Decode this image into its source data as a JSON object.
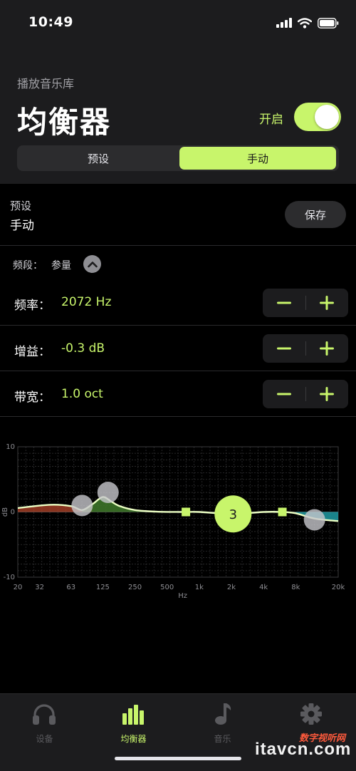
{
  "status_bar": {
    "time": "10:49"
  },
  "header": {
    "breadcrumb": "播放音乐库",
    "title": "均衡器",
    "toggle_label": "开启",
    "toggle_on": true
  },
  "segmented": {
    "preset": "预设",
    "manual": "手动",
    "selected": "手动"
  },
  "preset_row": {
    "caption": "预设",
    "value": "手动",
    "save_label": "保存"
  },
  "band": {
    "label": "频段：",
    "value": "参量"
  },
  "params": [
    {
      "label": "频率：",
      "value": "2072 Hz"
    },
    {
      "label": "增益：",
      "value": "-0.3 dB"
    },
    {
      "label": "带宽：",
      "value": "1.0 oct"
    }
  ],
  "chart": {
    "ylabel": "dB",
    "xlabel": "Hz",
    "y_ticks": [
      "10",
      "0",
      "-10"
    ],
    "x_ticks": [
      "20",
      "32",
      "63",
      "125",
      "250",
      "500",
      "1k",
      "2k",
      "4k",
      "8k",
      "20k"
    ],
    "selected_band_number": "3",
    "colors": {
      "accent": "#c8f56b",
      "handle_gray": "#c7c7cc",
      "low_fill": "#b5452a",
      "high_fill": "#1f9aa2"
    }
  },
  "chart_data": {
    "type": "line",
    "xlabel": "Hz",
    "ylabel": "dB",
    "ylim": [
      -10,
      10
    ],
    "xlim": [
      20,
      20000
    ],
    "x_scale": "log",
    "grid": true,
    "series": [
      {
        "x": [
          20,
          40,
          63,
          80,
          100,
          125,
          150,
          180,
          250,
          400,
          700,
          1000,
          2000,
          4000,
          6000,
          8000,
          12000,
          20000
        ],
        "y": [
          0.6,
          1.1,
          0.9,
          0.3,
          1.2,
          2.3,
          1.6,
          0.9,
          0.3,
          0.05,
          0.0,
          0.0,
          -0.3,
          0.0,
          0.0,
          -0.2,
          -1.0,
          -1.4
        ]
      }
    ],
    "handles": [
      {
        "label": "",
        "x": 80,
        "y": 1.0
      },
      {
        "label": "",
        "x": 140,
        "y": 3.0
      },
      {
        "label": "",
        "x": 750,
        "y": 0.0
      },
      {
        "label": "3",
        "x": 2072,
        "y": -0.3
      },
      {
        "label": "",
        "x": 6000,
        "y": 0.0
      },
      {
        "label": "",
        "x": 12000,
        "y": -1.2
      }
    ]
  },
  "tabbar": {
    "items": [
      {
        "label": "设备",
        "icon": "headphones-icon",
        "active": false
      },
      {
        "label": "均衡器",
        "icon": "equalizer-icon",
        "active": true
      },
      {
        "label": "音乐",
        "icon": "music-note-icon",
        "active": false
      },
      {
        "label": "",
        "icon": "gear-icon",
        "active": false
      }
    ]
  },
  "watermark": {
    "top": "数字视听网",
    "main": "itavcn.com"
  }
}
